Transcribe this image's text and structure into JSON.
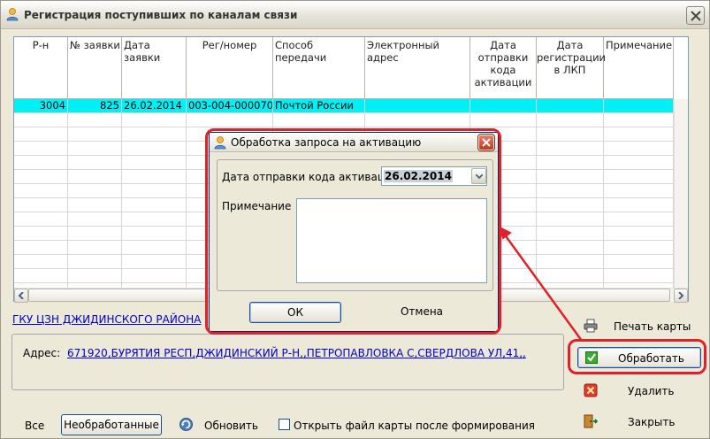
{
  "window": {
    "title": "Регистрация поступивших по каналам связи"
  },
  "grid": {
    "columns": [
      "Р-н",
      "№ заявки",
      "Дата заявки",
      "Рег/номер",
      "Способ передачи",
      "Электронный адрес",
      "Дата отправки кода активации",
      "Дата регистрации в ЛКП",
      "Примечание"
    ],
    "rows": [
      [
        "3004",
        "825",
        "26.02.2014",
        "003-004-000070",
        "Почтой России",
        "",
        "",
        "",
        ""
      ]
    ]
  },
  "org_link": "ГКУ ЦЗН ДЖИДИНСКОГО РАЙОНА",
  "address": {
    "label": "Адрес:",
    "value": "671920,БУРЯТИЯ РЕСП,ДЖИДИНСКИЙ Р-Н,,ПЕТРОПАВЛОВКА С,СВЕРДЛОВА УЛ,41,,"
  },
  "actions": {
    "print": "Печать карты",
    "process": "Обработать",
    "delete": "Удалить",
    "close": "Закрыть"
  },
  "bottom": {
    "all": "Все",
    "unprocessed": "Необработанные",
    "refresh": "Обновить",
    "open_file": "Открыть файл карты  после формирования"
  },
  "dialog": {
    "title": "Обработка запроса на активацию",
    "date_label": "Дата отправки кода активации",
    "date_value": "26.02.2014",
    "note_label": "Примечание",
    "note_value": "",
    "ok": "ОК",
    "cancel": "Отмена"
  },
  "colors": {
    "selected_row": "#00F0F5",
    "highlight": "#E0202A",
    "link": "#0000CC"
  },
  "icons": {
    "app": "user-icon",
    "print": "printer-icon",
    "process": "check-icon",
    "delete": "delete-icon",
    "close": "exit-door-icon",
    "refresh": "refresh-icon"
  }
}
